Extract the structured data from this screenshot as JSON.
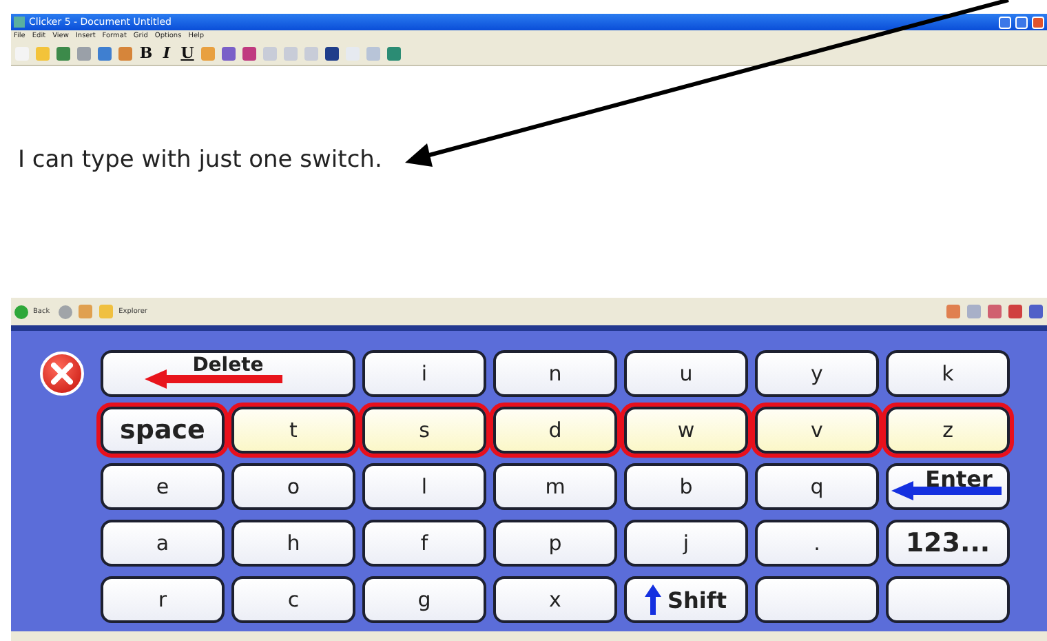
{
  "window": {
    "title": "Clicker 5 - Document Untitled"
  },
  "menu": [
    "File",
    "Edit",
    "View",
    "Insert",
    "Format",
    "Grid",
    "Options",
    "Help"
  ],
  "format_buttons": [
    "B",
    "I",
    "U"
  ],
  "document": {
    "text": "I can type with just one switch."
  },
  "nav": {
    "back": "Back",
    "explorer": "Explorer"
  },
  "grid": {
    "rows": [
      {
        "highlighted": false,
        "cells": [
          {
            "kind": "close"
          },
          {
            "kind": "delete",
            "label": "Delete"
          },
          {
            "kind": "letter",
            "label": "i"
          },
          {
            "kind": "letter",
            "label": "n"
          },
          {
            "kind": "letter",
            "label": "u"
          },
          {
            "kind": "letter",
            "label": "y"
          },
          {
            "kind": "letter",
            "label": "k"
          }
        ]
      },
      {
        "highlighted": true,
        "cells": [
          {
            "kind": "word",
            "label": "space"
          },
          {
            "kind": "letter",
            "label": "t"
          },
          {
            "kind": "letter",
            "label": "s"
          },
          {
            "kind": "letter",
            "label": "d"
          },
          {
            "kind": "letter",
            "label": "w"
          },
          {
            "kind": "letter",
            "label": "v"
          },
          {
            "kind": "letter",
            "label": "z"
          }
        ]
      },
      {
        "highlighted": false,
        "cells": [
          {
            "kind": "letter",
            "label": "e"
          },
          {
            "kind": "letter",
            "label": "o"
          },
          {
            "kind": "letter",
            "label": "l"
          },
          {
            "kind": "letter",
            "label": "m"
          },
          {
            "kind": "letter",
            "label": "b"
          },
          {
            "kind": "letter",
            "label": "q"
          },
          {
            "kind": "enter",
            "label": "Enter"
          }
        ]
      },
      {
        "highlighted": false,
        "cells": [
          {
            "kind": "letter",
            "label": "a"
          },
          {
            "kind": "letter",
            "label": "h"
          },
          {
            "kind": "letter",
            "label": "f"
          },
          {
            "kind": "letter",
            "label": "p"
          },
          {
            "kind": "letter",
            "label": "j"
          },
          {
            "kind": "letter",
            "label": "."
          },
          {
            "kind": "word",
            "label": "123..."
          }
        ]
      },
      {
        "highlighted": false,
        "cells": [
          {
            "kind": "letter",
            "label": "r"
          },
          {
            "kind": "letter",
            "label": "c"
          },
          {
            "kind": "letter",
            "label": "g"
          },
          {
            "kind": "letter",
            "label": "x"
          },
          {
            "kind": "shift",
            "label": "Shift"
          },
          {
            "kind": "blank"
          },
          {
            "kind": "blank"
          }
        ]
      }
    ]
  }
}
